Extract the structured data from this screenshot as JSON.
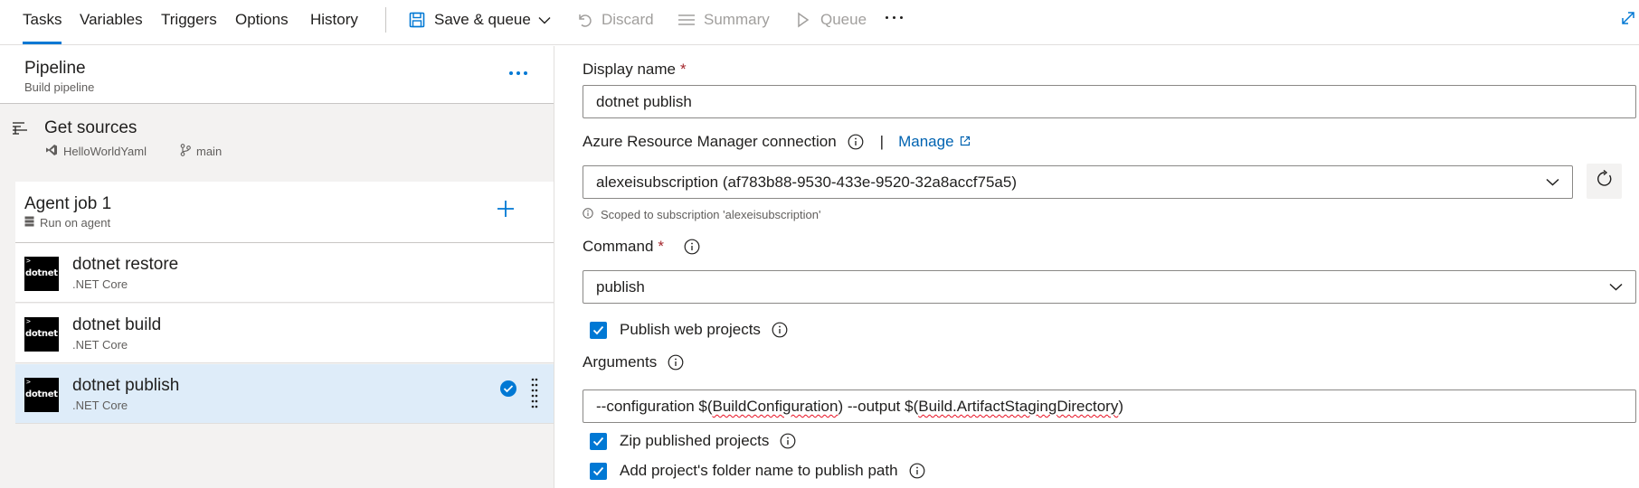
{
  "toolbar": {
    "tabs": [
      {
        "label": "Tasks",
        "active": true
      },
      {
        "label": "Variables",
        "active": false
      },
      {
        "label": "Triggers",
        "active": false
      },
      {
        "label": "Options",
        "active": false
      },
      {
        "label": "History",
        "active": false
      }
    ],
    "save_queue_label": "Save & queue",
    "discard_label": "Discard",
    "summary_label": "Summary",
    "queue_label": "Queue",
    "accent_color": "#0078d4"
  },
  "pipeline": {
    "title": "Pipeline",
    "subtitle": "Build pipeline"
  },
  "get_sources": {
    "title": "Get sources",
    "repo": "HelloWorldYaml",
    "branch": "main"
  },
  "agent_job": {
    "title": "Agent job 1",
    "subtitle": "Run on agent"
  },
  "tasks": [
    {
      "title": "dotnet restore",
      "subtitle": ".NET Core",
      "icon_text": "dotnet",
      "selected": false
    },
    {
      "title": "dotnet build",
      "subtitle": ".NET Core",
      "icon_text": "dotnet",
      "selected": false
    },
    {
      "title": "dotnet publish",
      "subtitle": ".NET Core",
      "icon_text": "dotnet",
      "selected": true
    }
  ],
  "details": {
    "display_name_label": "Display name",
    "display_name_value": "dotnet publish",
    "arm_connection_label": "Azure Resource Manager connection",
    "manage_label": "Manage",
    "arm_connection_value": "alexeisubscription (af783b88-9530-433e-9520-32a8accf75a5)",
    "scope_hint": "Scoped to subscription 'alexeisubscription'",
    "command_label": "Command",
    "command_value": "publish",
    "publish_web_projects_label": "Publish web projects",
    "publish_web_projects_checked": true,
    "arguments_label": "Arguments",
    "arguments_parts": [
      "--configuration $(",
      "BuildConfiguration",
      ") --output $(",
      "Build.ArtifactStagingDirectory",
      ")"
    ],
    "zip_label": "Zip published projects",
    "zip_checked": true,
    "add_folder_label": "Add project's folder name to publish path",
    "add_folder_checked": true,
    "required_marker": "*"
  }
}
